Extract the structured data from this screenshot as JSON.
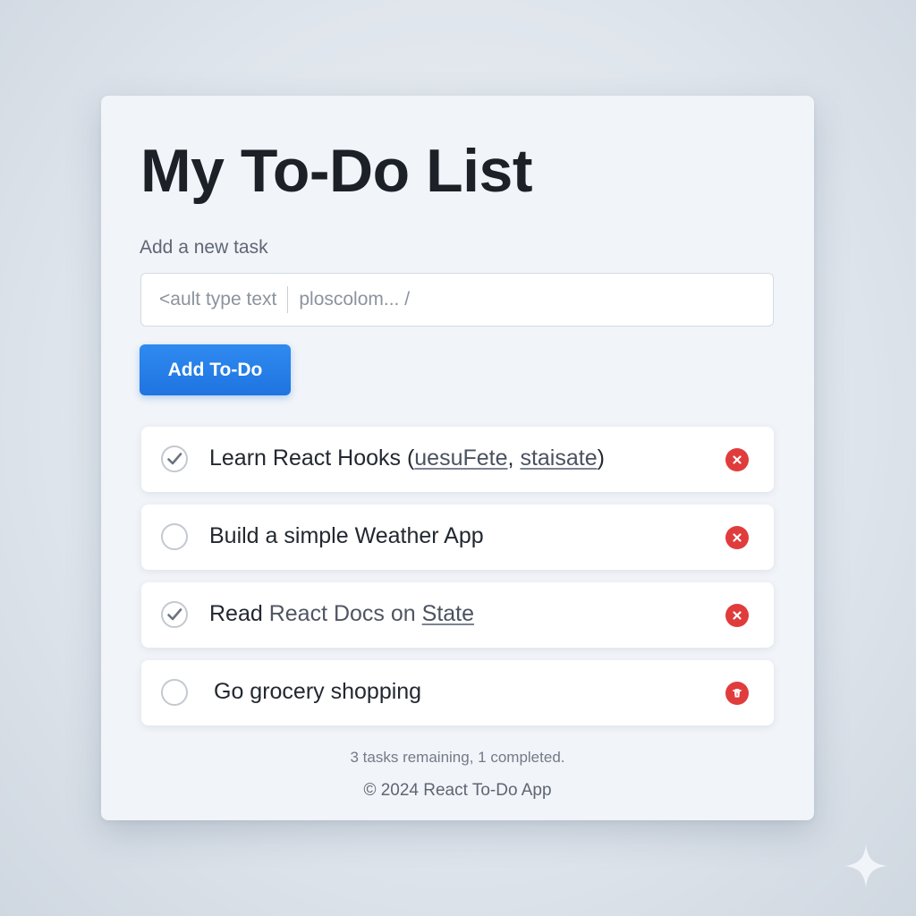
{
  "app": {
    "title": "My To-Do List"
  },
  "new_task": {
    "label": "Add a new task",
    "value_part1": "<ault type text",
    "value_part2": "ploscolom... /",
    "button_label": "Add To-Do"
  },
  "todos": [
    {
      "checked": true,
      "text_prefix": "Learn React Hooks (",
      "link1": "uesuFete",
      "sep": ", ",
      "link2": "staisate",
      "text_suffix": ")",
      "action_icon": "close-circle-icon"
    },
    {
      "checked": false,
      "text": "Build a simple Weather App",
      "action_icon": "close-circle-icon"
    },
    {
      "checked": true,
      "text_prefix": "Read ",
      "text_muted": "React Docs on ",
      "link": "State",
      "action_icon": "close-circle-icon"
    },
    {
      "checked": false,
      "text": "Go grocery shopping",
      "action_icon": "trash-icon"
    }
  ],
  "footer": {
    "status": "3 tasks remaining, 1 completed.",
    "copyright": "© 2024 React To-Do App"
  },
  "colors": {
    "accent": "#1f74e0",
    "danger": "#e03c3c",
    "text": "#1c2027"
  }
}
